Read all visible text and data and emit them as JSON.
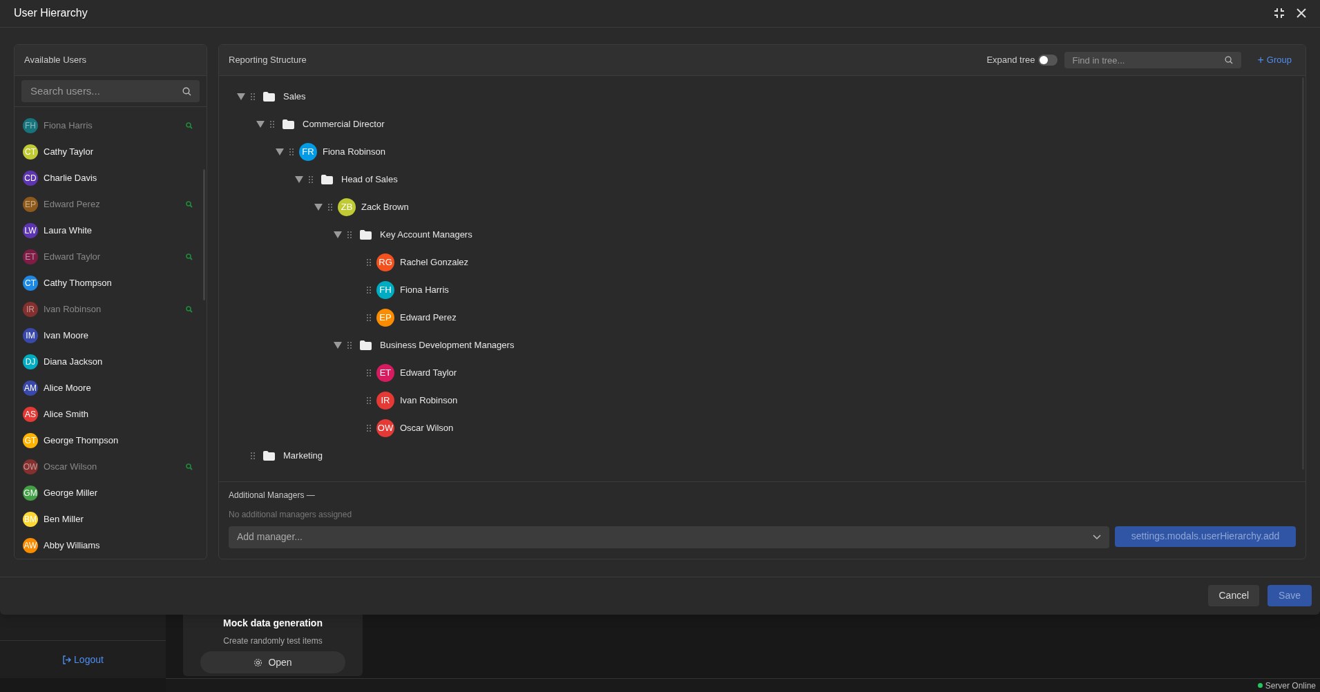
{
  "window": {
    "title": "User Hierarchy"
  },
  "available_users": {
    "title": "Available Users",
    "search": {
      "placeholder": "Search users..."
    },
    "users": [
      {
        "initials": "FH",
        "name": "Fiona Harris",
        "color": "#17737c",
        "assigned": true
      },
      {
        "initials": "CT",
        "name": "Cathy Taylor",
        "color": "#c0ca33",
        "assigned": false
      },
      {
        "initials": "CD",
        "name": "Charlie Davis",
        "color": "#5e35b1",
        "assigned": false
      },
      {
        "initials": "EP",
        "name": "Edward Perez",
        "color": "#8e5a1c",
        "assigned": true
      },
      {
        "initials": "LW",
        "name": "Laura White",
        "color": "#5e35b1",
        "assigned": false
      },
      {
        "initials": "ET",
        "name": "Edward Taylor",
        "color": "#7d1d45",
        "assigned": true
      },
      {
        "initials": "CT",
        "name": "Cathy Thompson",
        "color": "#1e88e5",
        "assigned": false
      },
      {
        "initials": "IR",
        "name": "Ivan Robinson",
        "color": "#83302e",
        "assigned": true
      },
      {
        "initials": "IM",
        "name": "Ivan Moore",
        "color": "#3949ab",
        "assigned": false
      },
      {
        "initials": "DJ",
        "name": "Diana Jackson",
        "color": "#00acc1",
        "assigned": false
      },
      {
        "initials": "AM",
        "name": "Alice Moore",
        "color": "#3949ab",
        "assigned": false
      },
      {
        "initials": "AS",
        "name": "Alice Smith",
        "color": "#e53935",
        "assigned": false
      },
      {
        "initials": "GT",
        "name": "George Thompson",
        "color": "#ffb300",
        "assigned": false
      },
      {
        "initials": "OW",
        "name": "Oscar Wilson",
        "color": "#83302e",
        "assigned": true
      },
      {
        "initials": "GM",
        "name": "George Miller",
        "color": "#43a047",
        "assigned": false
      },
      {
        "initials": "BM",
        "name": "Ben Miller",
        "color": "#fdd835",
        "assigned": false
      },
      {
        "initials": "AW",
        "name": "Abby Williams",
        "color": "#fb8c00",
        "assigned": false
      }
    ]
  },
  "reporting_structure": {
    "title": "Reporting Structure",
    "expand_tree": {
      "label": "Expand tree",
      "on": false
    },
    "find": {
      "placeholder": "Find in tree..."
    },
    "add_group": {
      "icon": "+",
      "label": "Group"
    },
    "tree": [
      {
        "kind": "group",
        "label": "Sales",
        "expanded": true,
        "children": [
          {
            "kind": "group",
            "label": "Commercial Director",
            "expanded": true,
            "children": [
              {
                "kind": "user",
                "initials": "FR",
                "label": "Fiona Robinson",
                "color": "#039be5",
                "expanded": true,
                "children": [
                  {
                    "kind": "group",
                    "label": "Head of Sales",
                    "expanded": true,
                    "children": [
                      {
                        "kind": "user",
                        "initials": "ZB",
                        "label": "Zack Brown",
                        "color": "#c0ca33",
                        "expanded": true,
                        "children": [
                          {
                            "kind": "group",
                            "label": "Key Account Managers",
                            "expanded": true,
                            "children": [
                              {
                                "kind": "user",
                                "initials": "RG",
                                "label": "Rachel Gonzalez",
                                "color": "#f4511e"
                              },
                              {
                                "kind": "user",
                                "initials": "FH",
                                "label": "Fiona Harris",
                                "color": "#00acc1"
                              },
                              {
                                "kind": "user",
                                "initials": "EP",
                                "label": "Edward Perez",
                                "color": "#fb8c00"
                              }
                            ]
                          },
                          {
                            "kind": "group",
                            "label": "Business Development Managers",
                            "expanded": true,
                            "children": [
                              {
                                "kind": "user",
                                "initials": "ET",
                                "label": "Edward Taylor",
                                "color": "#d81b60"
                              },
                              {
                                "kind": "user",
                                "initials": "IR",
                                "label": "Ivan Robinson",
                                "color": "#e53935"
                              },
                              {
                                "kind": "user",
                                "initials": "OW",
                                "label": "Oscar Wilson",
                                "color": "#e53935"
                              }
                            ]
                          }
                        ]
                      }
                    ]
                  }
                ]
              }
            ]
          }
        ]
      },
      {
        "kind": "group",
        "label": "Marketing"
      }
    ],
    "additional_managers": {
      "title": "Additional Managers —",
      "empty_text": "No additional managers assigned",
      "select": {
        "placeholder": "Add manager..."
      },
      "add_button": "settings.modals.userHierarchy.add"
    }
  },
  "footer": {
    "cancel": "Cancel",
    "save": "Save"
  },
  "background": {
    "logout": "Logout",
    "card": {
      "title": "Mock data generation",
      "subtitle": "Create randomly test items",
      "button": "Open"
    },
    "status": "Server Online"
  }
}
